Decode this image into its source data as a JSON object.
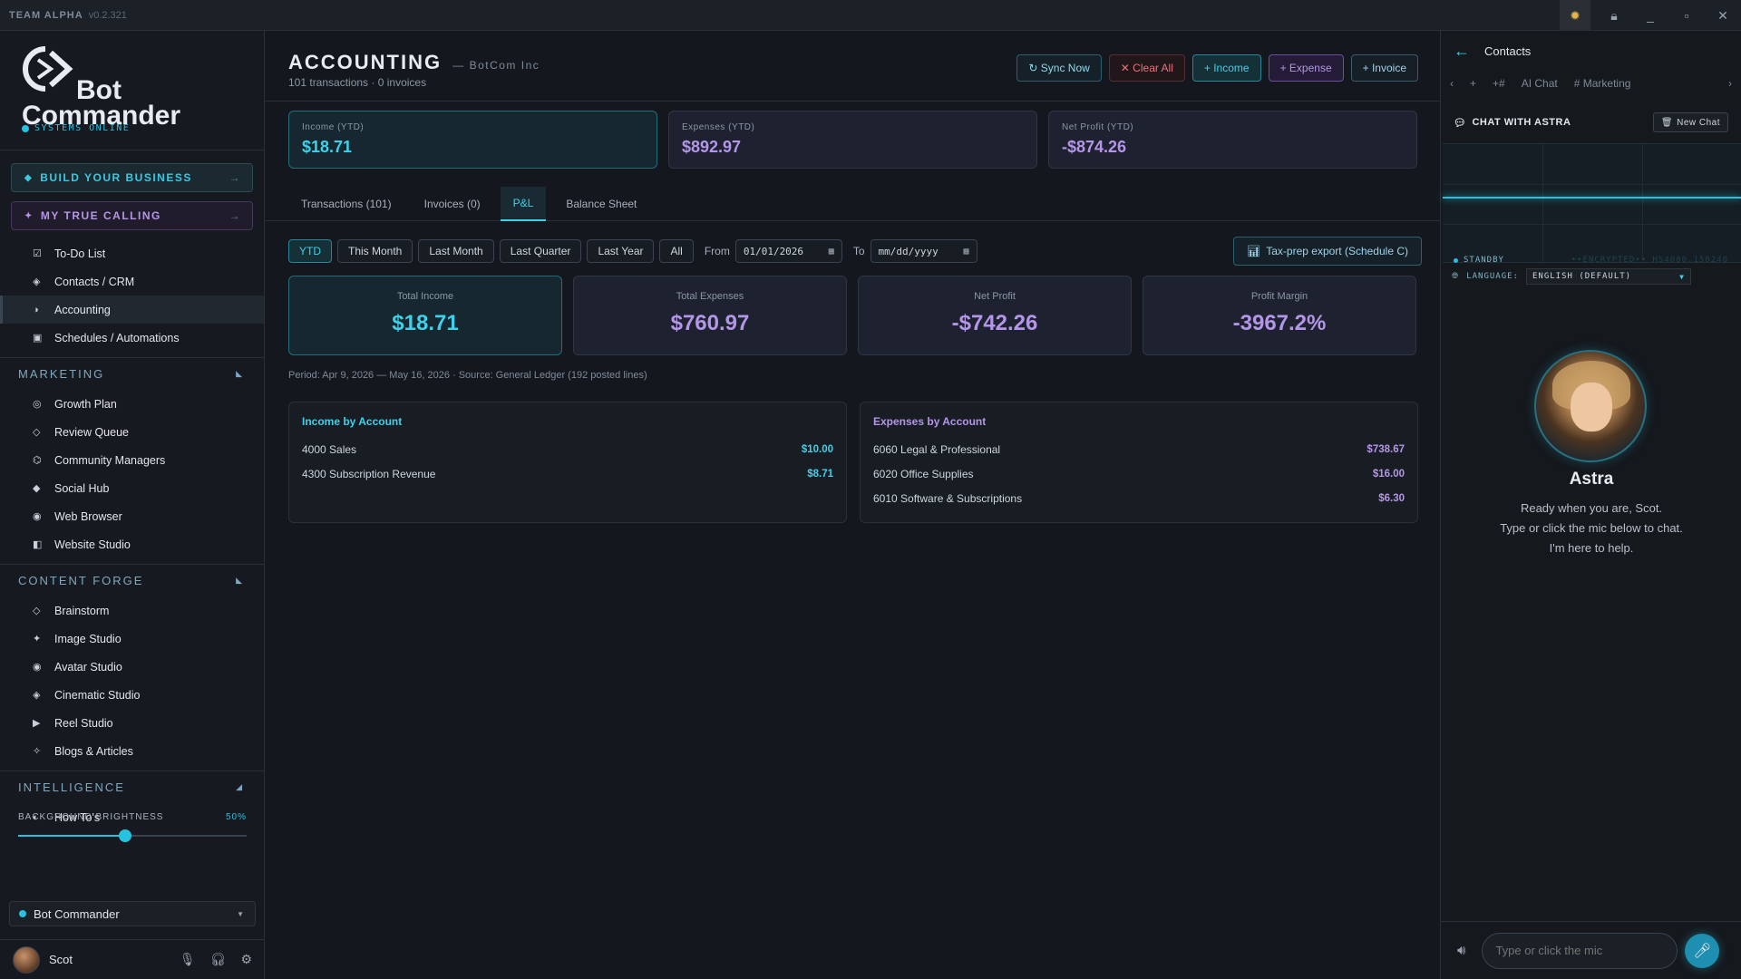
{
  "titlebar": {
    "app_name": "TEAM ALPHA",
    "version": "v0.2.321"
  },
  "brand": {
    "line1": "Bot",
    "line2": "Commander",
    "status": "SYSTEMS ONLINE"
  },
  "sidebar": {
    "pills": [
      {
        "label": "BUILD YOUR BUSINESS",
        "arrow": "→"
      },
      {
        "label": "MY TRUE CALLING",
        "arrow": "→"
      }
    ],
    "top_items": [
      {
        "icon": "checkbox-icon",
        "glyph": "☑",
        "label": "To-Do List"
      },
      {
        "icon": "contacts-icon",
        "glyph": "◈",
        "label": "Contacts / CRM"
      },
      {
        "icon": "accounting-icon",
        "glyph": "◑",
        "label": "Accounting",
        "active": true
      },
      {
        "icon": "schedule-icon",
        "glyph": "▣",
        "label": "Schedules / Automations"
      }
    ],
    "marketing": {
      "title": "MARKETING",
      "items": [
        {
          "icon": "growth-icon",
          "glyph": "◎",
          "label": "Growth Plan"
        },
        {
          "icon": "review-icon",
          "glyph": "◇",
          "label": "Review Queue"
        },
        {
          "icon": "community-icon",
          "glyph": "⌬",
          "label": "Community Managers"
        },
        {
          "icon": "social-icon",
          "glyph": "◆",
          "label": "Social Hub"
        },
        {
          "icon": "browser-icon",
          "glyph": "◉",
          "label": "Web Browser"
        },
        {
          "icon": "website-icon",
          "glyph": "◧",
          "label": "Website Studio"
        }
      ]
    },
    "content_forge": {
      "title": "CONTENT FORGE",
      "items": [
        {
          "icon": "brainstorm-icon",
          "glyph": "◇",
          "label": "Brainstorm"
        },
        {
          "icon": "image-icon",
          "glyph": "✦",
          "label": "Image Studio"
        },
        {
          "icon": "avatar-icon",
          "glyph": "◉",
          "label": "Avatar Studio"
        },
        {
          "icon": "cinematic-icon",
          "glyph": "◈",
          "label": "Cinematic Studio"
        },
        {
          "icon": "reel-icon",
          "glyph": "▶",
          "label": "Reel Studio"
        },
        {
          "icon": "blog-icon",
          "glyph": "✧",
          "label": "Blogs & Articles"
        }
      ]
    },
    "intelligence": {
      "title": "INTELLIGENCE",
      "items": [
        {
          "icon": "howto-icon",
          "glyph": "◐",
          "label": "How To's"
        }
      ]
    },
    "brightness": {
      "label": "BACKGROUND BRIGHTNESS",
      "value": "50%",
      "level": 0.47
    },
    "bot_select": "Bot Commander",
    "user": {
      "name": "Scot"
    }
  },
  "main": {
    "title": "ACCOUNTING",
    "company": "— BotCom Inc",
    "subtitle": "101 transactions · 0 invoices",
    "buttons": {
      "sync": "↻ Sync Now",
      "clear": "✕ Clear All",
      "income": "+ Income",
      "expense": "+ Expense",
      "invoice": "+ Invoice"
    },
    "kpis": [
      {
        "label": "Income (YTD)",
        "value": "$18.71"
      },
      {
        "label": "Expenses (YTD)",
        "value": "$892.97"
      },
      {
        "label": "Net Profit (YTD)",
        "value": "-$874.26"
      }
    ],
    "tabs": [
      {
        "label": "Transactions (101)"
      },
      {
        "label": "Invoices (0)"
      },
      {
        "label": "P&L",
        "active": true
      },
      {
        "label": "Balance Sheet"
      }
    ],
    "filters": {
      "ranges": [
        "YTD",
        "This Month",
        "Last Month",
        "Last Quarter",
        "Last Year",
        "All"
      ],
      "from_label": "From",
      "from_value": "01/01/2026",
      "to_label": "To",
      "to_value": "mm/dd/yyyy",
      "export": "Tax-prep export (Schedule C)"
    },
    "summary": [
      {
        "label": "Total Income",
        "value": "$18.71"
      },
      {
        "label": "Total Expenses",
        "value": "$760.97"
      },
      {
        "label": "Net Profit",
        "value": "-$742.26"
      },
      {
        "label": "Profit Margin",
        "value": "-3967.2%"
      }
    ],
    "period": "Period: Apr 9, 2026 — May 16, 2026 · Source: General Ledger (192 posted lines)",
    "income_by_account": {
      "title": "Income by Account",
      "rows": [
        {
          "account": "4000 Sales",
          "amount": "$10.00"
        },
        {
          "account": "4300 Subscription Revenue",
          "amount": "$8.71"
        }
      ]
    },
    "expenses_by_account": {
      "title": "Expenses by Account",
      "rows": [
        {
          "account": "6060 Legal & Professional",
          "amount": "$738.67"
        },
        {
          "account": "6020 Office Supplies",
          "amount": "$16.00"
        },
        {
          "account": "6010 Software & Subscriptions",
          "amount": "$6.30"
        }
      ]
    }
  },
  "right": {
    "title": "Contacts",
    "tabs": [
      "+",
      "+#",
      "AI Chat",
      "# Marketing"
    ],
    "chat_header": "CHAT WITH ASTRA",
    "new_chat": "New Chat",
    "standby": "STANDBY",
    "encrypted": "••ENCRYPTED•• HS4000.150240",
    "language_label": "LANGUAGE:",
    "language_value": "ENGLISH (DEFAULT)",
    "assistant_name": "Astra",
    "assistant_lines": [
      "Ready when you are, Scot.",
      "Type or click the mic below to chat.",
      "I'm here to help."
    ],
    "input_placeholder": "Type or click the mic"
  }
}
